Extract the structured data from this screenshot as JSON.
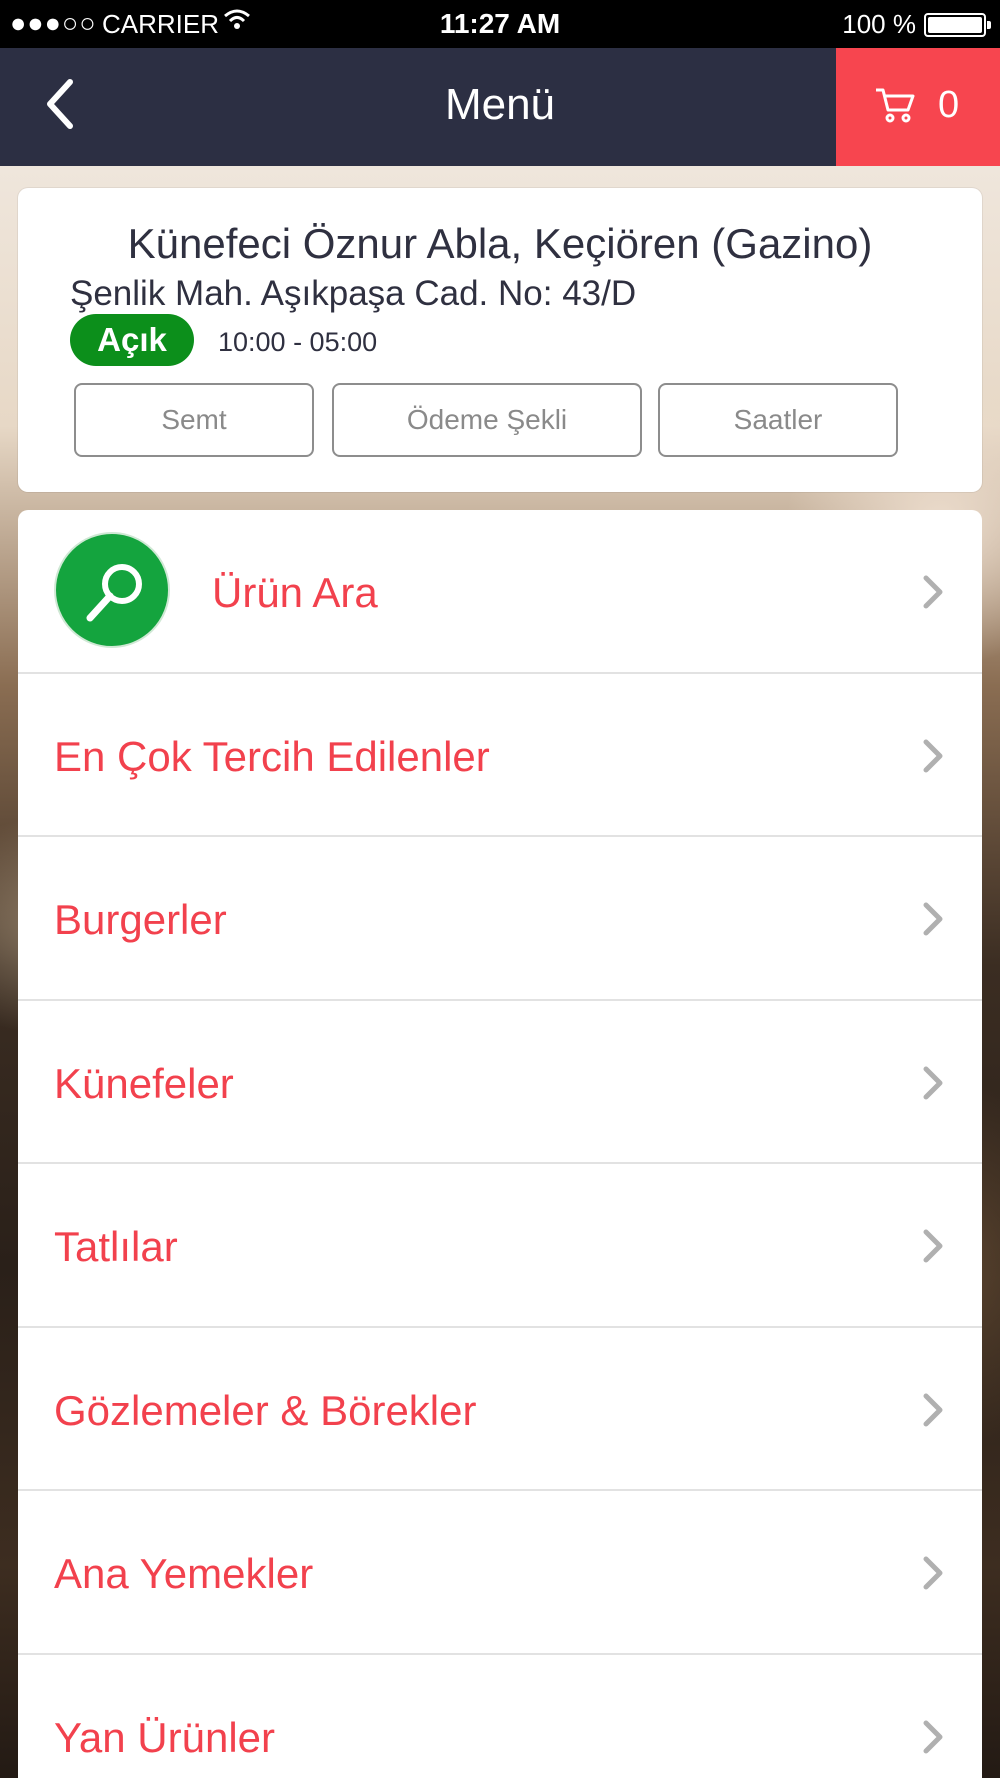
{
  "status_bar": {
    "signal": "●●●○○",
    "carrier": "CARRIER",
    "time": "11:27 AM",
    "battery": "100 %"
  },
  "nav": {
    "title": "Menü",
    "cart_count": "0"
  },
  "restaurant": {
    "name": "Künefeci Öznur Abla, Keçiören (Gazino)",
    "address": "Şenlik Mah. Aşıkpaşa Cad. No: 43/D",
    "status": "Açık",
    "hours": "10:00 - 05:00",
    "status_color": "#0c8f1b",
    "buttons": [
      "Semt",
      "Ödeme Şekli",
      "Saatler"
    ]
  },
  "menu": {
    "search_label": "Ürün Ara",
    "categories": [
      "En Çok Tercih Edilenler",
      "Burgerler",
      "Künefeler",
      "Tatlılar",
      "Gözlemeler & Börekler",
      "Ana Yemekler",
      "Yan Ürünler"
    ]
  },
  "colors": {
    "accent": "#f7454f",
    "nav_bg": "#2c2f43",
    "category_text": "#f2414d",
    "search_green": "#14a43e"
  },
  "icons": {
    "back": "chevron-left-icon",
    "cart": "shopping-cart-icon",
    "search": "magnifier-icon",
    "row_arrow": "chevron-right-icon"
  }
}
